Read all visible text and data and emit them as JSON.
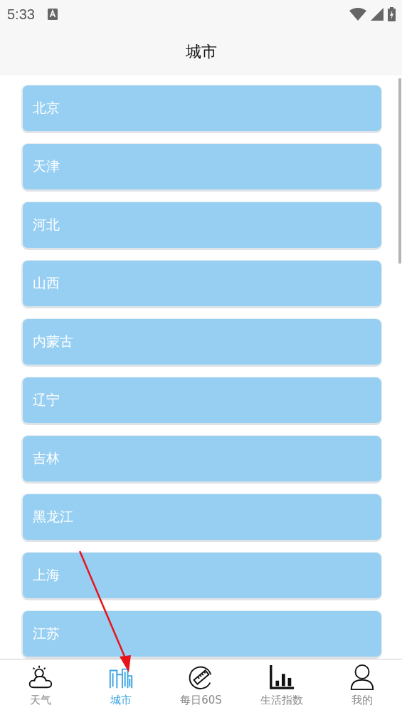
{
  "status_bar": {
    "time": "5:33"
  },
  "header": {
    "title": "城市"
  },
  "cities": [
    {
      "name": "北京"
    },
    {
      "name": "天津"
    },
    {
      "name": "河北"
    },
    {
      "name": "山西"
    },
    {
      "name": "内蒙古"
    },
    {
      "name": "辽宁"
    },
    {
      "name": "吉林"
    },
    {
      "name": "黑龙江"
    },
    {
      "name": "上海"
    },
    {
      "name": "江苏"
    }
  ],
  "tabs": [
    {
      "label": "天气",
      "kind": "weather",
      "selected": false
    },
    {
      "label": "城市",
      "kind": "city",
      "selected": true
    },
    {
      "label": "每日60S",
      "kind": "ruler",
      "selected": false
    },
    {
      "label": "生活指数",
      "kind": "chart",
      "selected": false
    },
    {
      "label": "我的",
      "kind": "person",
      "selected": false
    }
  ]
}
